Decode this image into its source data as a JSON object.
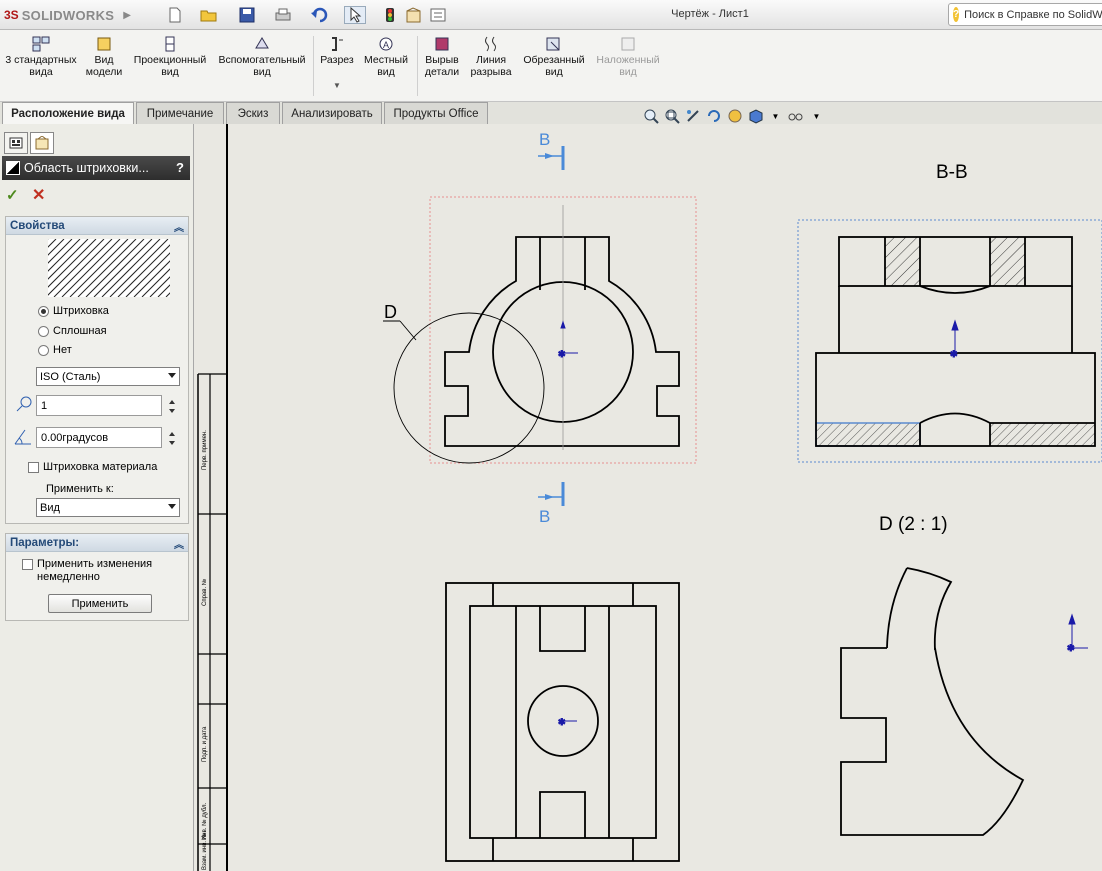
{
  "app": {
    "logo": "SOLIDWORKS",
    "document_title": "Чертёж - Лист1",
    "help_search_placeholder": "Поиск в Справке по SolidWorks"
  },
  "quick_access": [
    "new-icon",
    "open-icon",
    "save-icon",
    "print-icon",
    "undo-icon",
    "select-icon",
    "rebuild-icon",
    "file-properties-icon",
    "options-icon"
  ],
  "commands": [
    {
      "label": "3 стандартных вида",
      "icon": "three-views-icon"
    },
    {
      "label": "Вид модели",
      "icon": "model-view-icon"
    },
    {
      "label": "Проекционный вид",
      "icon": "projected-view-icon"
    },
    {
      "label": "Вспомогательный вид",
      "icon": "auxiliary-view-icon"
    },
    {
      "label": "Разрез",
      "icon": "section-view-icon"
    },
    {
      "label": "Местный вид",
      "icon": "detail-view-icon"
    },
    {
      "label": "Вырыв детали",
      "icon": "broken-out-section-icon"
    },
    {
      "label": "Линия разрыва",
      "icon": "break-icon"
    },
    {
      "label": "Обрезанный вид",
      "icon": "crop-view-icon"
    },
    {
      "label": "Наложенный вид",
      "icon": "alternate-position-icon"
    }
  ],
  "tabs": [
    "Расположение вида",
    "Примечание",
    "Эскиз",
    "Анализировать",
    "Продукты Office"
  ],
  "property_manager": {
    "title": "Область штриховки...",
    "help": "?",
    "properties": {
      "header": "Свойства",
      "options": [
        "Штриховка",
        "Сплошная",
        "Нет"
      ],
      "selected": "Штриховка",
      "pattern": "ISO (Сталь)",
      "scale": "1",
      "angle": "0.00градусов",
      "material_hatch_label": "Штриховка материала",
      "apply_to_label": "Применить к:",
      "apply_to": "Вид"
    },
    "parameters": {
      "header": "Параметры:",
      "apply_immediately_label": "Применить изменения немедленно",
      "apply_button": "Применить"
    }
  },
  "drawing": {
    "section_label_top": "B",
    "section_label_bottom": "B",
    "section_view_title": "B-B",
    "detail_circle_label": "D",
    "detail_view_title": "D  (2 : 1)",
    "title_block": [
      "Перв. примен.",
      "Справ. №",
      "Подп. и дата",
      "Инв. № дубл.",
      "Взам. инв. №"
    ]
  },
  "colors": {
    "accent_blue": "#4a8ad8",
    "sheet": "#e9e8e2",
    "origin_blue": "#1a1aa8",
    "hatch_bg": "#d8d8d4"
  }
}
